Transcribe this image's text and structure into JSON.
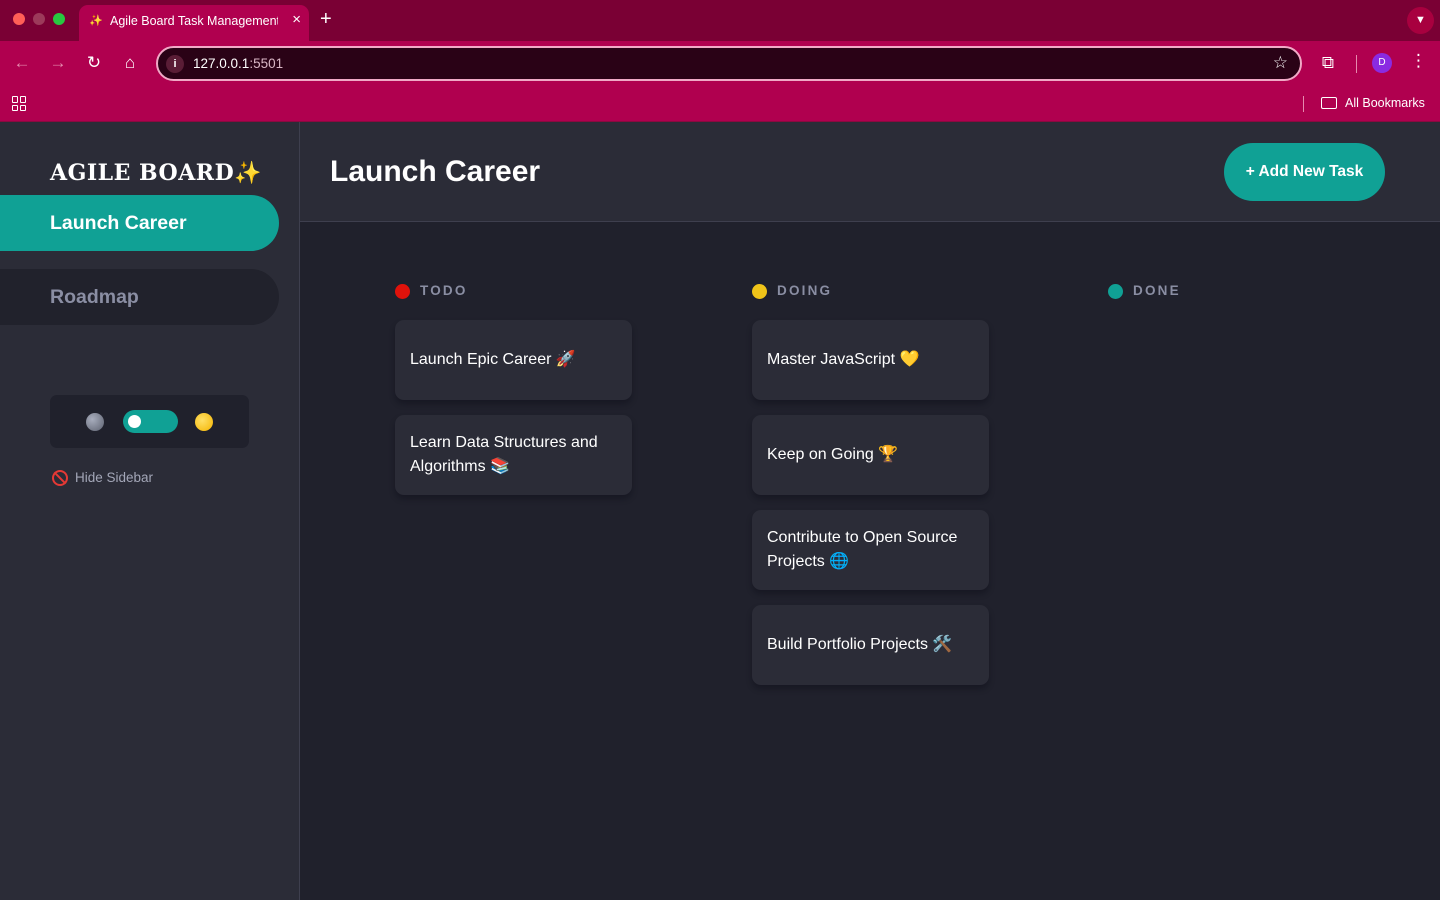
{
  "browser": {
    "tab_favicon": "✨",
    "tab_title": "Agile Board Task Management",
    "url_host": "127.0.0.1",
    "url_port": ":5501",
    "bookmarks_label": "All Bookmarks",
    "avatar_letter": "D"
  },
  "sidebar": {
    "logo_text": "AGILE BOARD",
    "logo_emoji": "✨",
    "boards": [
      {
        "label": "Launch Career"
      },
      {
        "label": "Roadmap"
      }
    ],
    "hide_label": "Hide Sidebar"
  },
  "header": {
    "title": "Launch Career",
    "add_task_label": "+ Add New Task"
  },
  "columns": [
    {
      "label": "TODO",
      "color": "#e0120b",
      "tasks": [
        {
          "title": "Launch Epic Career 🚀"
        },
        {
          "title": "Learn Data Structures and Algorithms 📚"
        }
      ]
    },
    {
      "label": "DOING",
      "color": "#f0c419",
      "tasks": [
        {
          "title": "Master JavaScript 💛"
        },
        {
          "title": "Keep on Going 🏆"
        },
        {
          "title": "Contribute to Open Source Projects 🌐"
        },
        {
          "title": "Build Portfolio Projects 🛠️"
        }
      ]
    },
    {
      "label": "DONE",
      "color": "#10a195",
      "tasks": []
    }
  ],
  "colors": {
    "accent": "#10a195",
    "sidebar_bg": "#2b2c37",
    "main_bg": "#20212c",
    "browser_frame": "#b0004f"
  }
}
